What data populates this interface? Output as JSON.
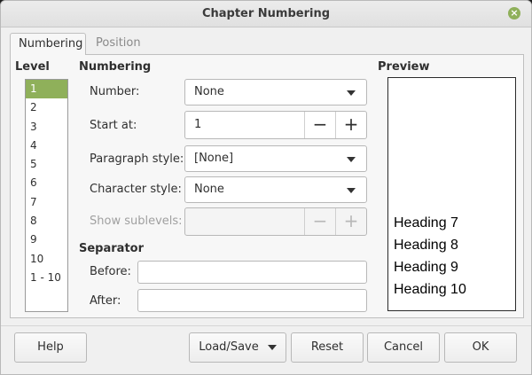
{
  "window": {
    "title": "Chapter Numbering",
    "close_icon": "close-icon",
    "accent": "#8fb05a"
  },
  "tabs": [
    {
      "label": "Numbering"
    },
    {
      "label": "Position"
    }
  ],
  "level": {
    "heading": "Level",
    "items": [
      "1",
      "2",
      "3",
      "4",
      "5",
      "6",
      "7",
      "8",
      "9",
      "10",
      "1 - 10"
    ],
    "selected": "1"
  },
  "numbering": {
    "heading": "Numbering",
    "number_label": "Number:",
    "number_value": "None",
    "start_label": "Start at:",
    "start_value": "1",
    "minus": "−",
    "plus": "+",
    "paragraph_label": "Paragraph style:",
    "paragraph_value": "[None]",
    "character_label": "Character style:",
    "character_value": "None",
    "sublevels_label": "Show sublevels:",
    "sublevels_value": ""
  },
  "separator": {
    "heading": "Separator",
    "before_label": "Before:",
    "before_value": "",
    "after_label": "After:",
    "after_value": ""
  },
  "preview": {
    "heading": "Preview",
    "lines": [
      "Heading 7",
      "Heading 8",
      "Heading 9",
      "Heading 10"
    ]
  },
  "buttons": {
    "help": "Help",
    "load_save": "Load/Save",
    "reset": "Reset",
    "cancel": "Cancel",
    "ok": "OK"
  }
}
